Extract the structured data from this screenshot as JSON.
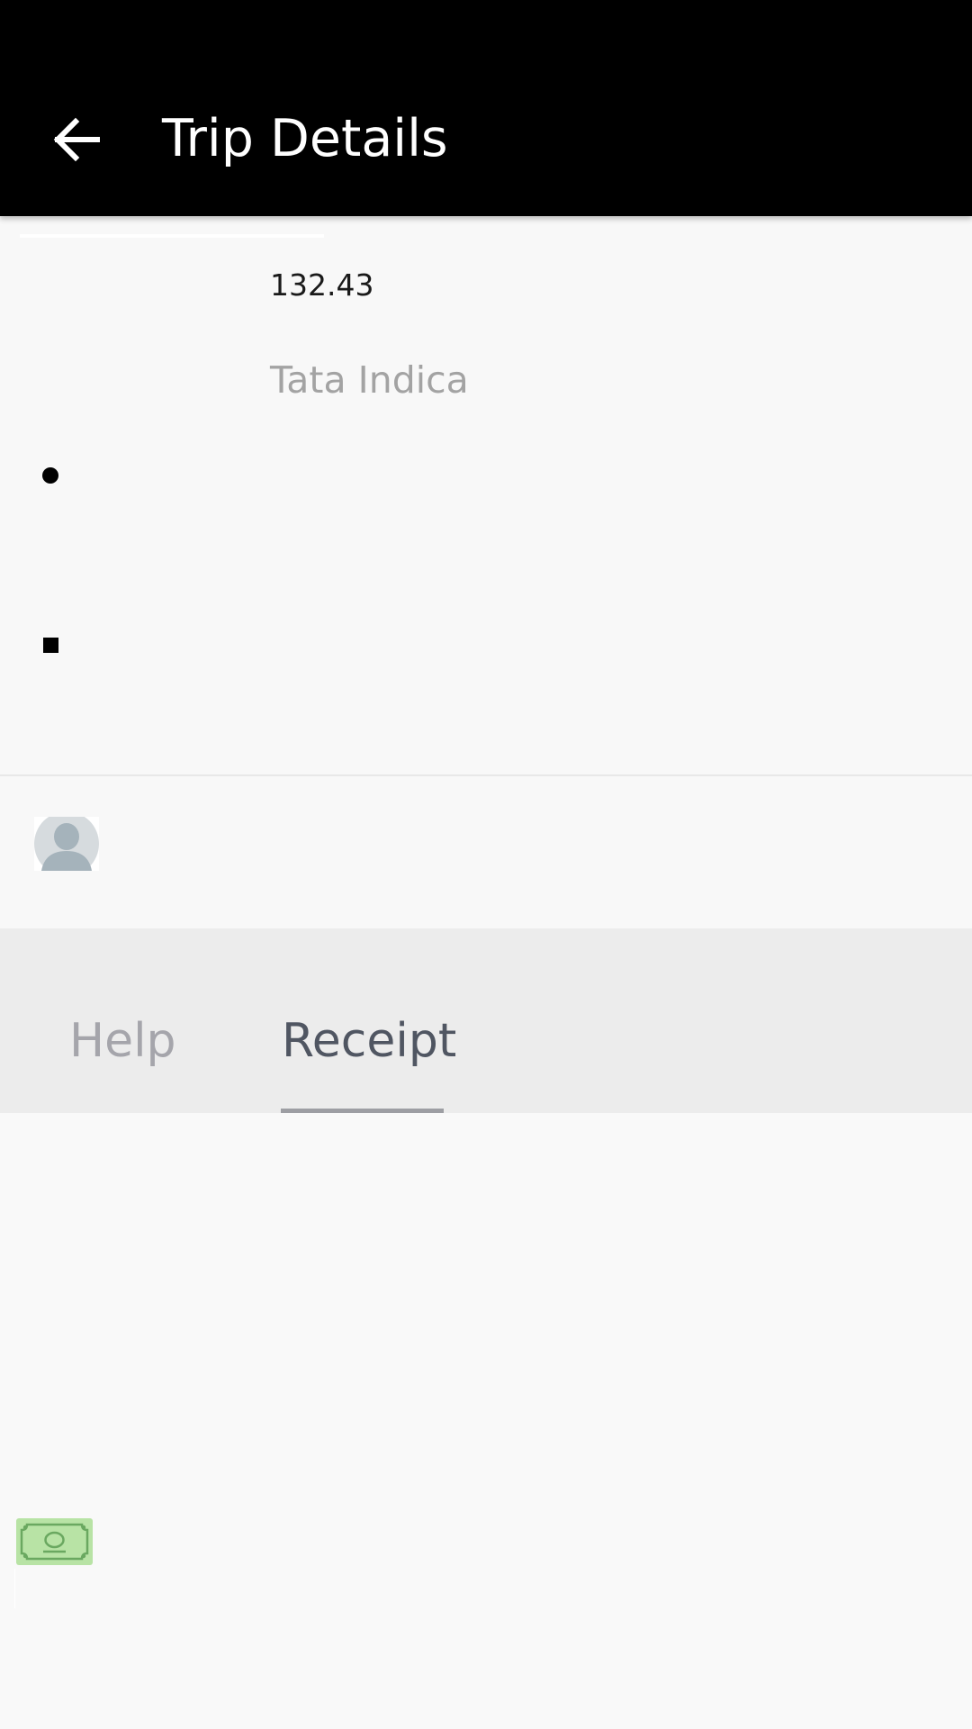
{
  "app_bar": {
    "title": "Trip Details",
    "back_icon": "arrow-left-icon",
    "background": "#000000",
    "text_color": "#ffffff"
  },
  "trip": {
    "fare": "132.43",
    "vehicle": "Tata Indica",
    "pickup_icon": "pickup-dot-icon",
    "dropoff_icon": "dropoff-square-icon"
  },
  "driver": {
    "avatar_icon": "person-avatar-icon"
  },
  "tabs": [
    {
      "label": "Help",
      "selected": false
    },
    {
      "label": "Receipt",
      "selected": true
    }
  ],
  "receipt": {
    "payment_icon": "cash-icon",
    "payment_icon_color": "#b8e3a5"
  },
  "colors": {
    "page_background": "#f9f9f9",
    "tab_bar_background": "#ececec",
    "selected_tab_text": "#505662",
    "unselected_tab_text": "#a5a5ab",
    "tab_indicator": "#9d9ea3",
    "secondary_text": "#a3a3a3"
  }
}
